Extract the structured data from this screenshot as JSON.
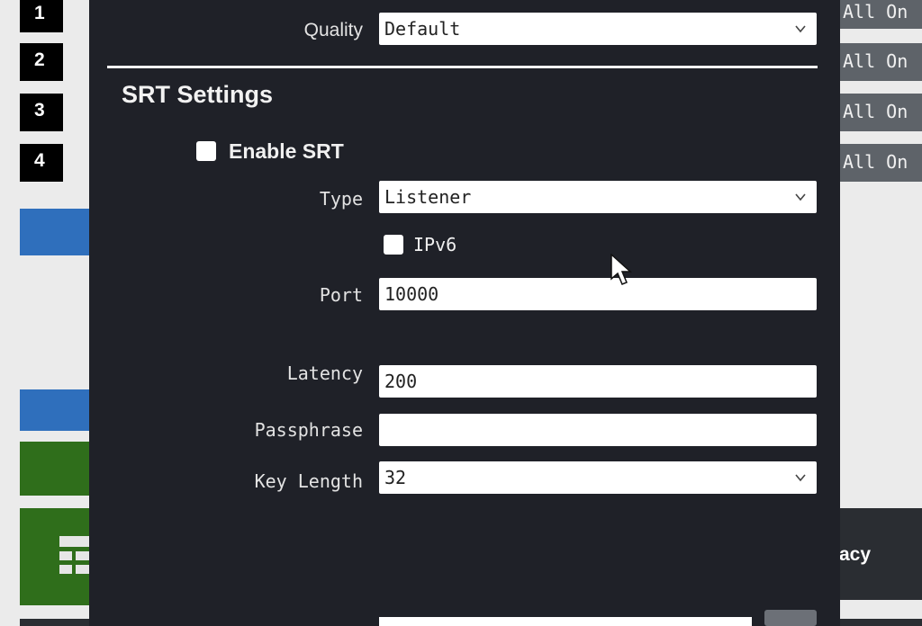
{
  "background": {
    "channels": [
      "1",
      "2",
      "3",
      "4"
    ],
    "channel_status": [
      "All On",
      "All On",
      "All On",
      "All On"
    ],
    "legacy_label": "acy"
  },
  "modal": {
    "quality": {
      "label": "Quality",
      "value": "Default"
    },
    "srt": {
      "title": "SRT Settings",
      "enable_label": "Enable SRT",
      "type": {
        "label": "Type",
        "value": "Listener"
      },
      "ipv6_label": "IPv6",
      "port": {
        "label": "Port",
        "value": "10000"
      },
      "latency": {
        "label": "Latency",
        "value": "200"
      },
      "passphrase": {
        "label": "Passphrase",
        "value": ""
      },
      "key_length": {
        "label": "Key Length",
        "value": "32"
      }
    }
  },
  "colors": {
    "modal_bg": "#1f2128",
    "badge_bg": "#000000",
    "status_bg": "#5e6369",
    "accent_blue": "#2f6fbc",
    "accent_green": "#2f6e1b"
  }
}
